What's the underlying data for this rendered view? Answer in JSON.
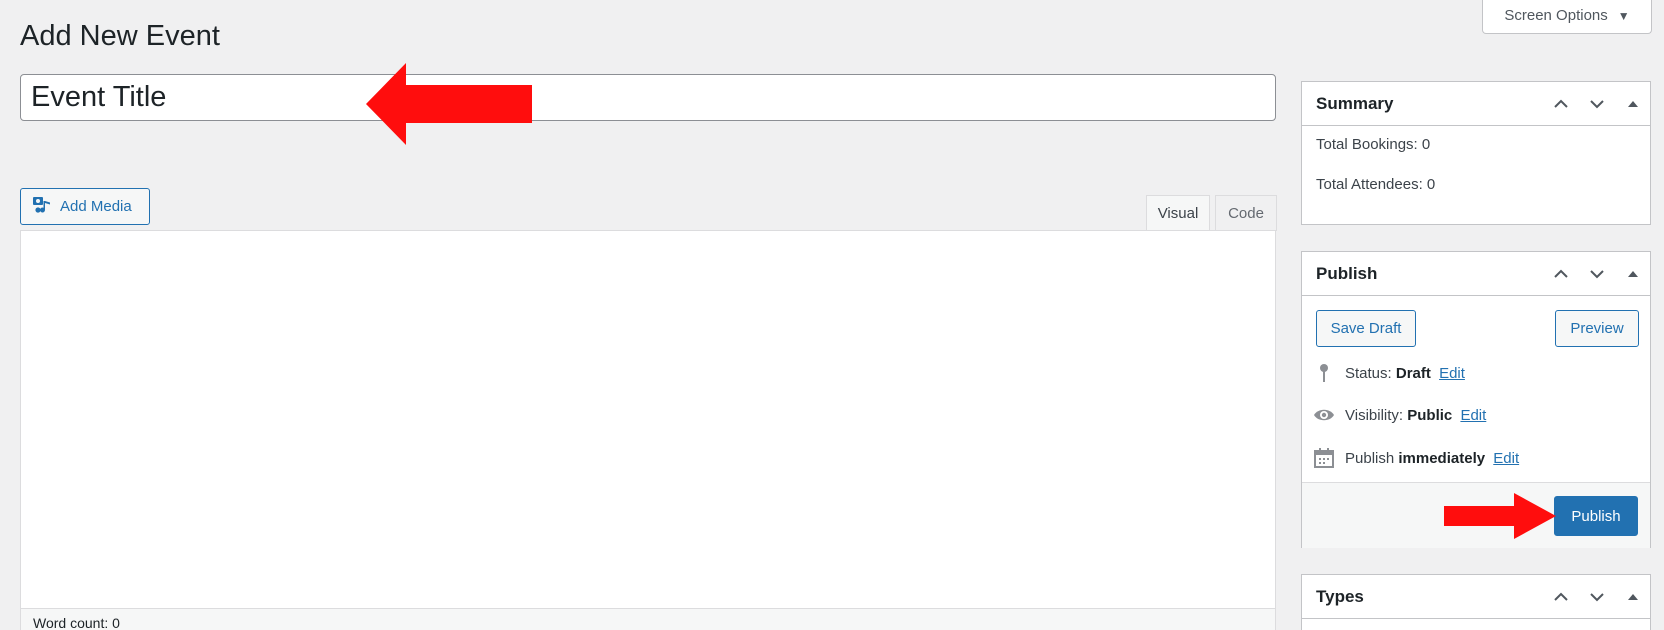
{
  "header": {
    "page_title": "Add New Event",
    "screen_options_label": "Screen Options",
    "screen_options_caret": "▼"
  },
  "title_field": {
    "value": "Event Title"
  },
  "editor": {
    "add_media_label": "Add Media",
    "tabs": [
      {
        "label": "Visual",
        "active": true
      },
      {
        "label": "Code",
        "active": false
      }
    ],
    "word_count_label": "Word count: 0"
  },
  "sidebar": {
    "summary": {
      "title": "Summary",
      "total_bookings": "Total Bookings: 0",
      "total_attendees": "Total Attendees: 0"
    },
    "publish": {
      "title": "Publish",
      "save_draft_label": "Save Draft",
      "preview_label": "Preview",
      "status_label": "Status:",
      "status_value": "Draft",
      "visibility_label": "Visibility:",
      "visibility_value": "Public",
      "publish_label": "Publish",
      "publish_value": "immediately",
      "edit_label": "Edit",
      "publish_button_label": "Publish"
    },
    "types": {
      "title": "Types"
    }
  },
  "colors": {
    "accent": "#2271b1",
    "annotation_arrow": "#ff0d0d",
    "background": "#f0f0f1"
  },
  "icons": [
    "media-icon",
    "chevron-up-icon",
    "chevron-down-icon",
    "triangle-up-icon",
    "pin-icon",
    "eye-icon",
    "calendar-icon",
    "caret-down-icon",
    "red-arrow-left-icon",
    "red-arrow-right-icon"
  ]
}
